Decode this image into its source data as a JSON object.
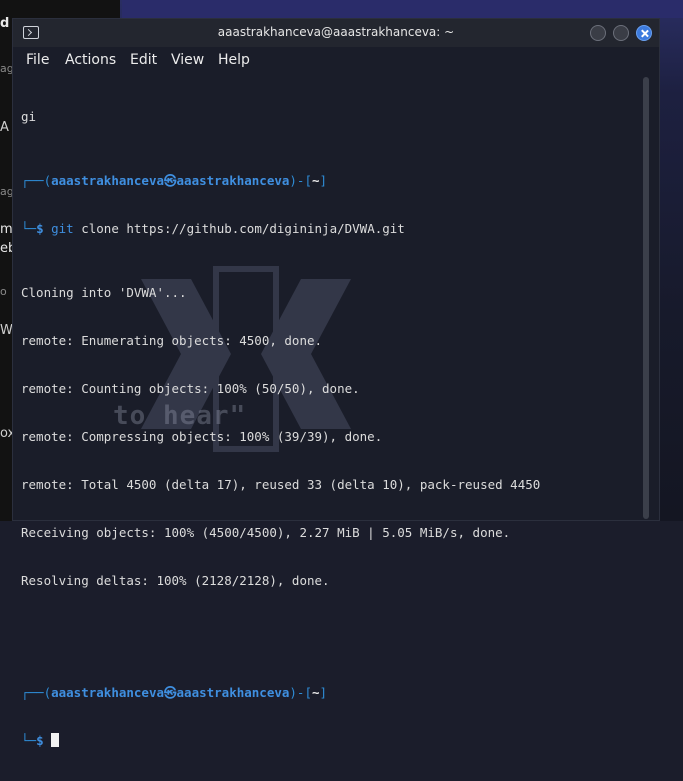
{
  "background": {
    "left_fragments": [
      "d",
      "ag",
      "A i",
      "ag",
      "m",
      "eb",
      "o",
      "Windows",
      "ox (OSCP"
    ]
  },
  "window": {
    "title": "aaastrakhanceva@aaastrakhanceva: ~",
    "close_color": "#3d7bde"
  },
  "menu": [
    "File",
    "Actions",
    "Edit",
    "View",
    "Help"
  ],
  "terminal": {
    "pre_text": "gi",
    "prompt1": {
      "frame_top_left": "┌──(",
      "user": "aaastrakhanceva",
      "at": "㉿",
      "host": "aaastrakhanceva",
      "frame_mid": ")-[",
      "dir": "~",
      "frame_end": "]",
      "frame_bottom": "└─",
      "symbol": "$",
      "cmd": "git",
      "args": " clone https://github.com/digininja/DVWA.git"
    },
    "output": [
      "Cloning into 'DVWA'...",
      "remote: Enumerating objects: 4500, done.",
      "remote: Counting objects: 100% (50/50), done.",
      "remote: Compressing objects: 100% (39/39), done.",
      "remote: Total 4500 (delta 17), reused 33 (delta 10), pack-reused 4450",
      "Receiving objects: 100% (4500/4500), 2.27 MiB | 5.05 MiB/s, done.",
      "Resolving deltas: 100% (2128/2128), done."
    ],
    "prompt2": {
      "frame_top_left": "┌──(",
      "user": "aaastrakhanceva",
      "at": "㉿",
      "host": "aaastrakhanceva",
      "frame_mid": ")-[",
      "dir": "~",
      "frame_end": "]",
      "frame_bottom": "└─",
      "symbol": "$"
    },
    "watermark_text": "to hear\""
  }
}
